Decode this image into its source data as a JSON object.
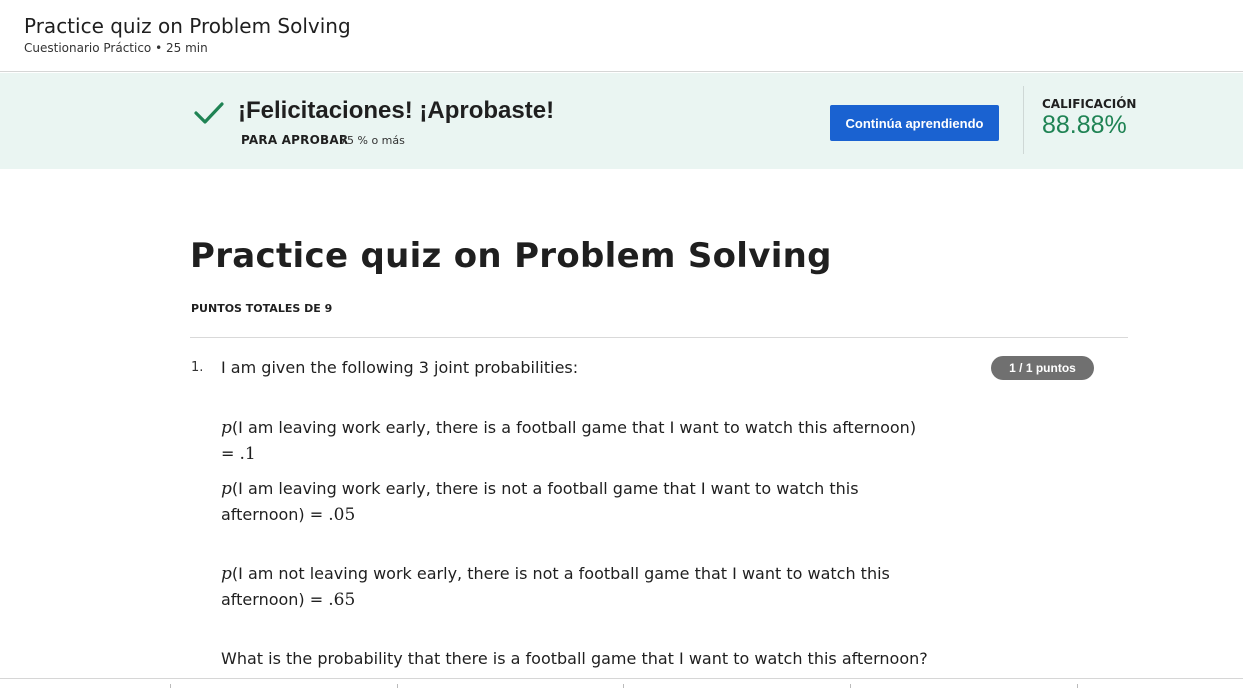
{
  "header": {
    "title": "Practice quiz on Problem Solving",
    "subtitle": "Cuestionario Práctico • 25 min"
  },
  "banner": {
    "title": "¡Felicitaciones! ¡Aprobaste!",
    "pass_label": "PARA APROBAR",
    "pass_value": "75 % o más",
    "continue_label": "Continúa aprendiendo",
    "grade_label": "CALIFICACIÓN",
    "grade_value": "88.88%",
    "accent_color": "#1f8354",
    "button_color": "#1a62d1"
  },
  "quiz": {
    "title": "Practice quiz on Problem Solving",
    "total_points": "PUNTOS TOTALES DE 9"
  },
  "question": {
    "number": "1.",
    "points": "1 / 1 puntos",
    "intro": "I am given the following 3 joint probabilities:",
    "items": [
      {
        "var": "p",
        "text": "(I am leaving work early, there is a football game that I want to watch this afternoon) = ",
        "value": ".1"
      },
      {
        "var": "p",
        "text": "(I am leaving work early, there is not a football game that I want to watch this afternoon) = ",
        "value": ".05"
      },
      {
        "var": "p",
        "text": "(I am not leaving work early, there is not a football game that I want to watch this afternoon) = ",
        "value": ".65"
      }
    ],
    "prompt": "What is the probability that there is a football game that I want to watch this afternoon?"
  }
}
